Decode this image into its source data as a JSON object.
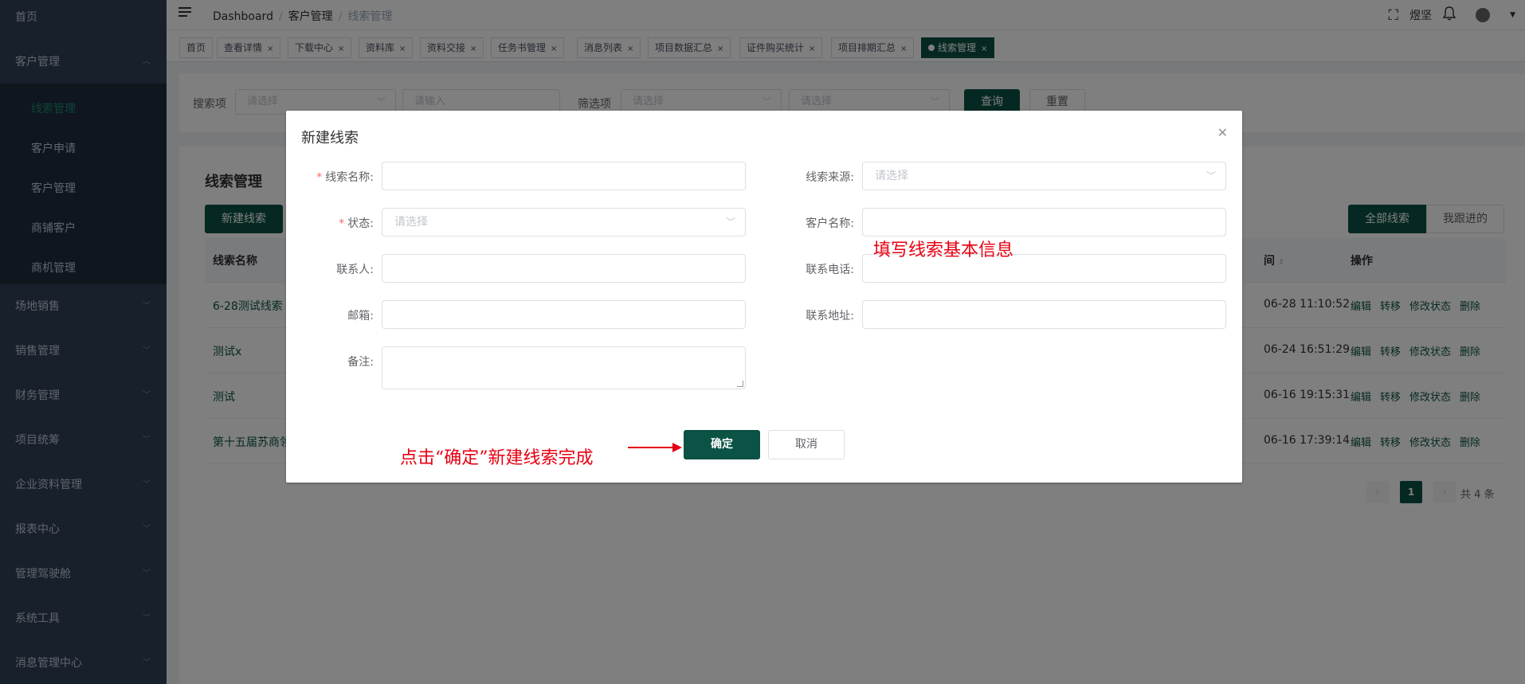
{
  "sidebar": {
    "items": [
      {
        "label": "首页",
        "has_children": false
      },
      {
        "label": "客户管理",
        "has_children": true,
        "expanded": true
      },
      {
        "label": "场地销售",
        "has_children": true
      },
      {
        "label": "销售管理",
        "has_children": true
      },
      {
        "label": "财务管理",
        "has_children": true
      },
      {
        "label": "项目统筹",
        "has_children": true
      },
      {
        "label": "企业资料管理",
        "has_children": true
      },
      {
        "label": "报表中心",
        "has_children": true
      },
      {
        "label": "管理驾驶舱",
        "has_children": true
      },
      {
        "label": "系统工具",
        "has_children": true
      },
      {
        "label": "消息管理中心",
        "has_children": true
      }
    ],
    "sub_items": [
      {
        "label": "线索管理",
        "active": true
      },
      {
        "label": "客户申请",
        "active": false
      },
      {
        "label": "客户管理",
        "active": false
      },
      {
        "label": "商铺客户",
        "active": false
      },
      {
        "label": "商机管理",
        "active": false
      }
    ]
  },
  "header": {
    "breadcrumb": [
      "Dashboard",
      "客户管理",
      "线索管理"
    ],
    "user": "煜坚"
  },
  "tags": [
    {
      "label": "首页",
      "closable": false,
      "active": false
    },
    {
      "label": "查看详情",
      "closable": true,
      "active": false
    },
    {
      "label": "下载中心",
      "closable": true,
      "active": false
    },
    {
      "label": "资料库",
      "closable": true,
      "active": false
    },
    {
      "label": "资料交接",
      "closable": true,
      "active": false
    },
    {
      "label": "任务书管理",
      "closable": true,
      "active": false
    },
    {
      "label": "消息列表",
      "closable": true,
      "active": false
    },
    {
      "label": "项目数据汇总",
      "closable": true,
      "active": false
    },
    {
      "label": "证件购买统计",
      "closable": true,
      "active": false
    },
    {
      "label": "项目排期汇总",
      "closable": true,
      "active": false
    },
    {
      "label": "线索管理",
      "closable": true,
      "active": true
    }
  ],
  "search": {
    "search_label": "搜索项",
    "select_placeholder": "请选择",
    "input_placeholder": "请输入",
    "filter_label": "筛选项",
    "filter_placeholder_1": "请选择",
    "filter_placeholder_2": "请选择",
    "query_button": "查询",
    "reset_button": "重置"
  },
  "list": {
    "title": "线索管理",
    "new_button": "新建线索",
    "tab_all": "全部线索",
    "tab_mine": "我跟进的",
    "columns": {
      "name": "线索名称",
      "time": "间",
      "ops": "操作"
    },
    "rows": [
      {
        "name": "6-28测试线索",
        "time": "06-28 11:10:52"
      },
      {
        "name": "测试x",
        "time": "06-24 16:51:29"
      },
      {
        "name": "测试",
        "time": "06-16 19:15:31"
      },
      {
        "name": "第十五届苏商领袖",
        "time": "06-16 17:39:14"
      }
    ],
    "ops": [
      "编辑",
      "转移",
      "修改状态",
      "删除"
    ],
    "pagination": {
      "current": "1",
      "total_text": "共 4 条"
    }
  },
  "dialog": {
    "title": "新建线索",
    "fields": {
      "name_label": "线索名称:",
      "source_label": "线索来源:",
      "source_placeholder": "请选择",
      "status_label": "状态:",
      "status_placeholder": "请选择",
      "customer_label": "客户名称:",
      "contact_label": "联系人:",
      "phone_label": "联系电话:",
      "email_label": "邮箱:",
      "address_label": "联系地址:",
      "remark_label": "备注:"
    },
    "confirm_button": "确定",
    "cancel_button": "取消"
  },
  "annotations": {
    "fill_info": "填写线索基本信息",
    "click_confirm": "点击“确定”新建线索完成"
  },
  "colors": {
    "brand": "#0b5345",
    "sidebar": "#304156",
    "annotation": "#e60012"
  }
}
